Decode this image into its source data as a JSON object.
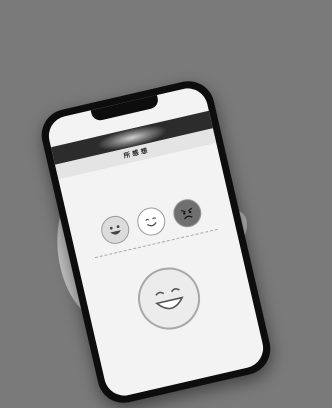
{
  "phone": {
    "status": {
      "time": "",
      "indicators": ""
    },
    "url": "",
    "page_title": "所 感 想",
    "body_text": "",
    "prompt": "",
    "faces": [
      {
        "name": "happy-face",
        "label": ""
      },
      {
        "name": "smile-face",
        "label": ""
      },
      {
        "name": "angry-face",
        "label": ""
      }
    ],
    "section_title": ""
  },
  "colors": {
    "background": "#7a7a7a",
    "phone_body": "#0d0d0d",
    "screen": "#f3f3f3",
    "banner": "#2c2c2c"
  }
}
